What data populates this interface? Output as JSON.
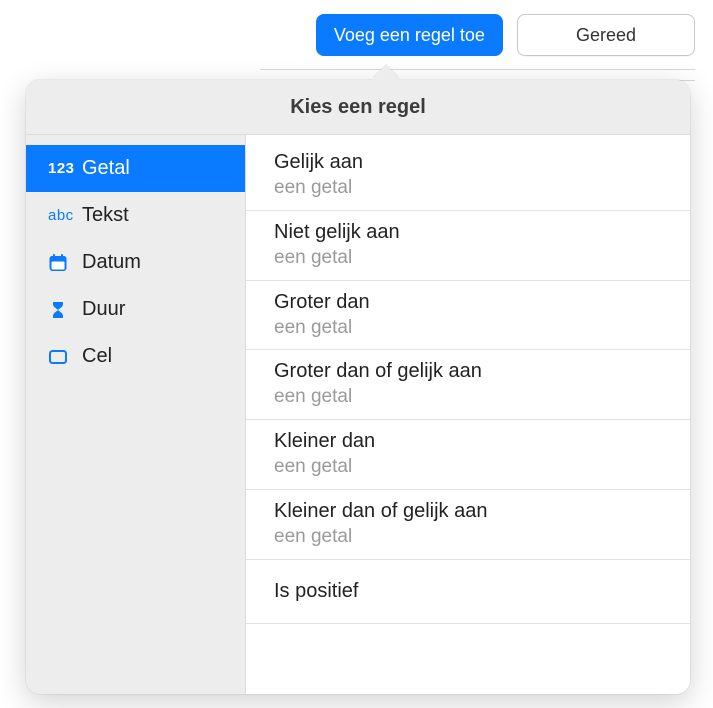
{
  "toolbar": {
    "add_rule_label": "Voeg een regel toe",
    "done_label": "Gereed"
  },
  "popover": {
    "title": "Kies een regel"
  },
  "sidebar": {
    "items": [
      {
        "icon": "number-icon",
        "glyph": "123",
        "label": "Getal",
        "selected": true
      },
      {
        "icon": "text-icon",
        "glyph": "abc",
        "label": "Tekst",
        "selected": false
      },
      {
        "icon": "calendar-icon",
        "glyph": "",
        "label": "Datum",
        "selected": false
      },
      {
        "icon": "hourglass-icon",
        "glyph": "",
        "label": "Duur",
        "selected": false
      },
      {
        "icon": "cell-icon",
        "glyph": "",
        "label": "Cel",
        "selected": false
      }
    ]
  },
  "options": [
    {
      "title": "Gelijk aan",
      "sub": "een getal"
    },
    {
      "title": "Niet gelijk aan",
      "sub": "een getal"
    },
    {
      "title": "Groter dan",
      "sub": "een getal"
    },
    {
      "title": "Groter dan of gelijk aan",
      "sub": "een getal"
    },
    {
      "title": "Kleiner dan",
      "sub": "een getal"
    },
    {
      "title": "Kleiner dan of gelijk aan",
      "sub": "een getal"
    },
    {
      "title": "Is positief",
      "sub": ""
    }
  ]
}
